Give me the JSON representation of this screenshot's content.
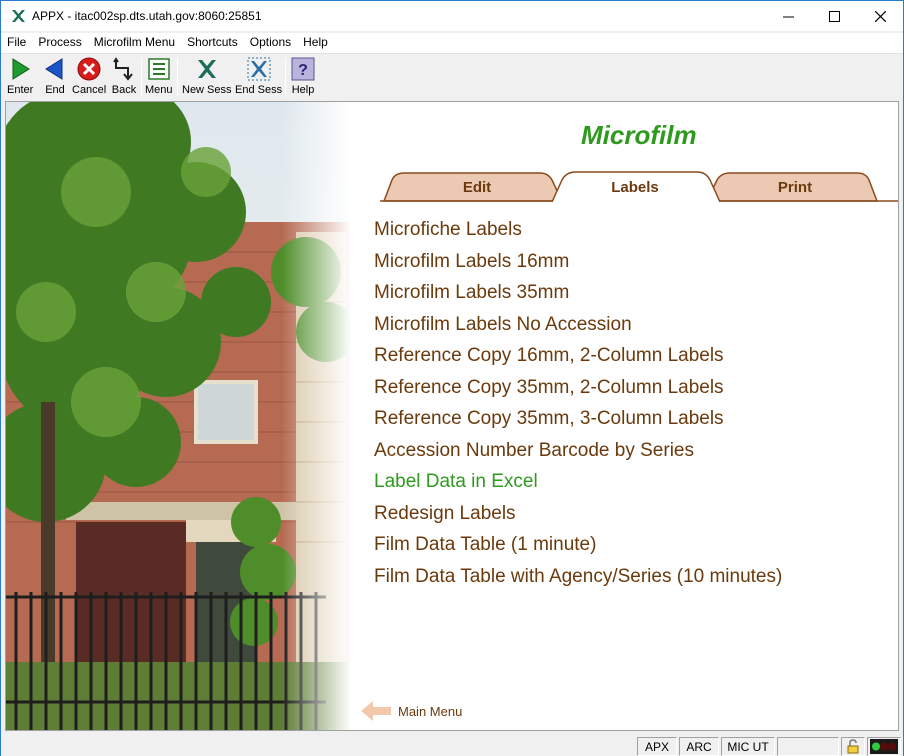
{
  "window": {
    "title": "APPX - itac002sp.dts.utah.gov:8060:25851"
  },
  "menubar": {
    "items": [
      "File",
      "Process",
      "Microfilm Menu",
      "Shortcuts",
      "Options",
      "Help"
    ]
  },
  "toolbar": {
    "enter": "Enter",
    "end": "End",
    "cancel": "Cancel",
    "back": "Back",
    "menu": "Menu",
    "new_sess": "New Sess",
    "end_sess": "End Sess",
    "help": "Help"
  },
  "main": {
    "heading": "Microfilm",
    "tabs": [
      {
        "label": "Edit",
        "active": false
      },
      {
        "label": "Labels",
        "active": true
      },
      {
        "label": "Print",
        "active": false
      }
    ],
    "items": [
      "Microfiche Labels",
      "Microfilm Labels 16mm",
      "Microfilm Labels 35mm",
      "Microfilm Labels No Accession",
      "Reference Copy 16mm, 2-Column Labels",
      "Reference Copy 35mm, 2-Column Labels",
      "Reference Copy 35mm, 3-Column Labels",
      "Accession Number Barcode by Series",
      "Label Data in Excel",
      "Redesign Labels",
      "Film Data Table (1 minute)",
      "Film Data Table with Agency/Series (10 minutes)"
    ],
    "active_item_index": 8,
    "main_menu_link": "Main Menu"
  },
  "statusbar": {
    "cells": [
      "APX",
      "ARC",
      "MIC UT"
    ]
  },
  "colors": {
    "heading_green": "#2e9a1e",
    "item_brown": "#6b3a0c",
    "tab_fill": "#ecc9b3"
  }
}
